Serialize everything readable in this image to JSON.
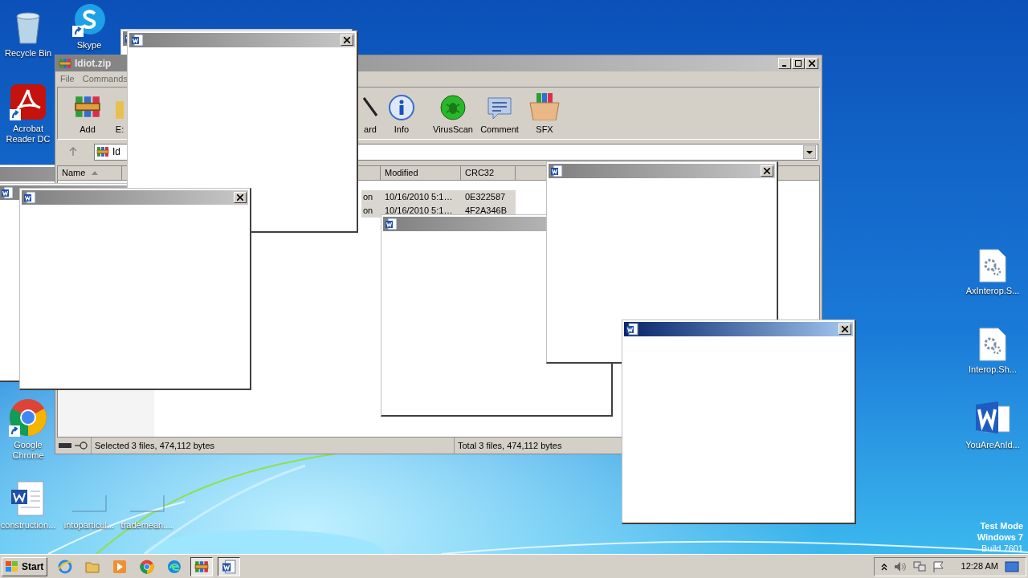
{
  "desktop_icons": [
    {
      "label": "Recycle Bin",
      "kind": "recycle"
    },
    {
      "label": "Skype",
      "kind": "skype"
    },
    {
      "label": "Acrobat Reader DC",
      "kind": "acrobat"
    },
    {
      "label": "Google Chrome",
      "kind": "chrome"
    },
    {
      "label": "construction...",
      "kind": "word_doc"
    },
    {
      "label": "intoparticul...",
      "kind": "blank"
    },
    {
      "label": "trademean....",
      "kind": "blank"
    },
    {
      "label": "AxInterop.S...",
      "kind": "gear_doc"
    },
    {
      "label": "Interop.Sh...",
      "kind": "gear_doc"
    },
    {
      "label": "YouAreAnId...",
      "kind": "word"
    }
  ],
  "archive_window": {
    "title": "Idiot.zip",
    "menu": [
      "File",
      "Commands"
    ],
    "toolbar": [
      {
        "label": "Add",
        "kind": "add"
      },
      {
        "label": "E:",
        "kind": "extract"
      },
      {
        "label": "ard",
        "kind": "wizard"
      },
      {
        "label": "Info",
        "kind": "info"
      },
      {
        "label": "VirusScan",
        "kind": "virus"
      },
      {
        "label": "Comment",
        "kind": "comment"
      },
      {
        "label": "SFX",
        "kind": "sfx"
      }
    ],
    "address": "Id",
    "columns": [
      "Name",
      "",
      "Modified",
      "CRC32"
    ],
    "rows": [
      {
        "column_2": "on",
        "modified": "10/16/2010 5:1…",
        "crc32": "0E322587",
        "selected": true
      },
      {
        "column_2": "on",
        "modified": "10/16/2010 5:1…",
        "crc32": "4F2A346B",
        "selected": true
      }
    ],
    "status": [
      "Selected 3 files, 474,112 bytes",
      "Total 3 files, 474,112 bytes"
    ]
  },
  "popups": [
    {
      "active": false
    },
    {
      "active": false
    },
    {
      "active": false
    },
    {
      "active": false
    },
    {
      "active": false
    },
    {
      "active": false
    },
    {
      "active": false
    },
    {
      "active": true
    }
  ],
  "taskbar": {
    "start": "Start",
    "items": [
      {
        "kind": "ie",
        "active": false
      },
      {
        "kind": "explorer",
        "active": false
      },
      {
        "kind": "media",
        "active": false
      },
      {
        "kind": "chrome",
        "active": false
      },
      {
        "kind": "edge",
        "active": false
      },
      {
        "kind": "winrar",
        "active": true
      },
      {
        "kind": "word",
        "active": true
      }
    ],
    "clock": "12:28 AM"
  },
  "os_notice": [
    "Test Mode",
    "Windows 7",
    "Build 7601"
  ]
}
